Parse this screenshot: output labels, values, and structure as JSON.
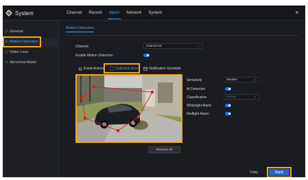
{
  "app": {
    "title": "System",
    "close_symbol": "×"
  },
  "nav": {
    "tabs": [
      "Channel",
      "Record",
      "Alarm",
      "Network",
      "System"
    ],
    "active": "Alarm"
  },
  "sidebar": {
    "items": [
      {
        "label": "General"
      },
      {
        "label": "Motion Detection"
      },
      {
        "label": "Video Loss"
      },
      {
        "label": "Abnormal Alarm"
      }
    ],
    "active_index": 1,
    "arrow": "▷"
  },
  "main": {
    "section_title": "Motion Detection",
    "channel_label": "Channel",
    "channel_value": "Channel 01",
    "enable_label": "Enable Motion Detection",
    "enable_on": true,
    "tabs": [
      "Event Actions",
      "Detection Area",
      "Notification Schedule"
    ],
    "active_tab": "Detection Area",
    "settings": [
      {
        "label": "Sensitivity",
        "kind": "select",
        "value": "Medium"
      },
      {
        "label": "AI Detection",
        "kind": "toggle",
        "value": true
      },
      {
        "label": "Classification",
        "kind": "select",
        "value": "Human",
        "disabled": true
      },
      {
        "label": "Whitelight Alarm",
        "kind": "toggle",
        "value": true
      },
      {
        "label": "Redlight Alarm",
        "kind": "toggle",
        "value": true
      }
    ],
    "remove_all_label": "Remove All",
    "copy_label": "Copy",
    "apply_label": "Apply",
    "chevron": "⌄"
  },
  "colors": {
    "accent": "#4aa3ff",
    "highlight": "#f5a623",
    "polygon": "#e02020",
    "apply": "#2b63c6"
  }
}
